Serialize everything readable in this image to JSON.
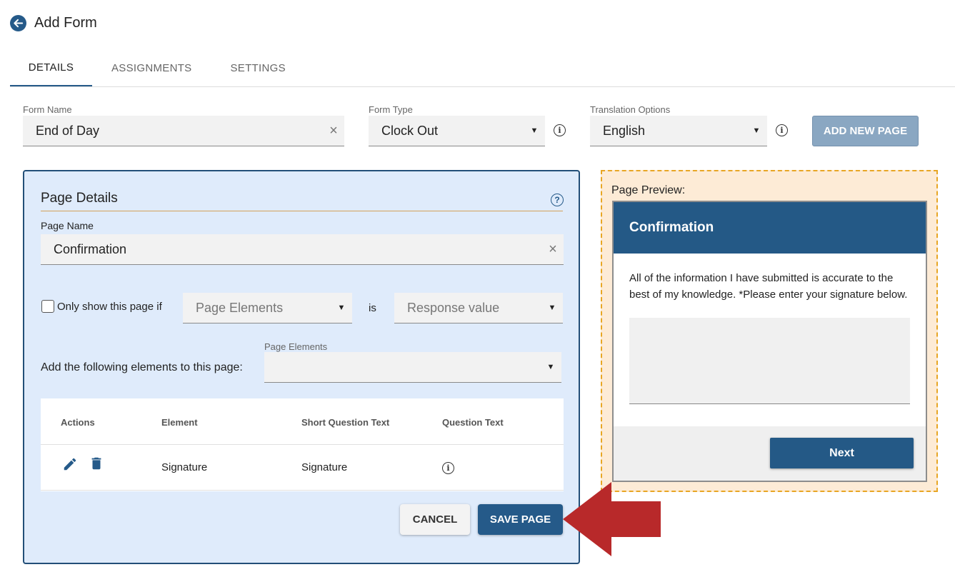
{
  "header": {
    "title": "Add Form"
  },
  "tabs": [
    {
      "label": "DETAILS",
      "active": true
    },
    {
      "label": "ASSIGNMENTS",
      "active": false
    },
    {
      "label": "SETTINGS",
      "active": false
    }
  ],
  "form": {
    "name_label": "Form Name",
    "name_value": "End of Day",
    "type_label": "Form Type",
    "type_value": "Clock Out",
    "translation_label": "Translation Options",
    "translation_value": "English",
    "add_page_label": "ADD NEW PAGE"
  },
  "page_details": {
    "title": "Page Details",
    "page_name_label": "Page Name",
    "page_name_value": "Confirmation",
    "condition_label": "Only show this page if",
    "condition_element_placeholder": "Page Elements",
    "condition_is": "is",
    "condition_value_placeholder": "Response value",
    "add_elements_label": "Add the following elements to this page:",
    "add_elements_field_label": "Page Elements",
    "add_elements_value": ""
  },
  "elements_table": {
    "columns": [
      "Actions",
      "Element",
      "Short Question Text",
      "Question Text"
    ],
    "rows": [
      {
        "element": "Signature",
        "short_question_text": "Signature"
      }
    ]
  },
  "actions": {
    "cancel": "CANCEL",
    "save": "SAVE PAGE"
  },
  "preview": {
    "label": "Page Preview:",
    "page_title": "Confirmation",
    "body_text": "All of the information I have submitted is accurate to the best of my knowledge. *Please enter your signature below.",
    "next_label": "Next"
  },
  "colors": {
    "primary": "#255a89",
    "panel_bg": "#dfebfb",
    "preview_bg": "#fdebd6",
    "preview_border": "#e8a624",
    "arrow": "#b8292a"
  },
  "icons": [
    "back-arrow-icon",
    "clear-icon",
    "dropdown-caret-icon",
    "info-icon",
    "help-icon",
    "edit-icon",
    "delete-icon",
    "checkbox-icon",
    "callout-arrow"
  ]
}
